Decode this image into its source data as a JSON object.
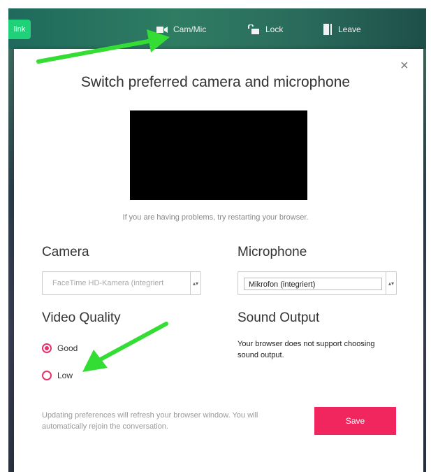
{
  "toolbar": {
    "link_label": "link",
    "cam_mic_label": "Cam/Mic",
    "lock_label": "Lock",
    "leave_label": "Leave"
  },
  "modal": {
    "title": "Switch preferred camera and microphone",
    "close_symbol": "×",
    "hint": "If you are having problems, try restarting your browser.",
    "camera": {
      "label": "Camera",
      "selected": "FaceTime HD-Kamera (integriert"
    },
    "microphone": {
      "label": "Microphone",
      "selected": "Mikrofon (integriert)"
    },
    "video_quality": {
      "label": "Video Quality",
      "options": [
        {
          "label": "Good",
          "checked": true
        },
        {
          "label": "Low",
          "checked": false
        }
      ]
    },
    "sound_output": {
      "label": "Sound Output",
      "note": "Your browser does not support choosing sound output."
    },
    "footer_note": "Updating preferences will refresh your browser window. You will automatically rejoin the conversation.",
    "save_label": "Save"
  },
  "colors": {
    "accent": "#f2265e",
    "radio": "#e8306a",
    "annotation_arrow": "#33dd33",
    "link_button": "#1fd27a"
  },
  "icons": [
    "video-camera-icon",
    "lock-icon",
    "door-icon",
    "close-icon",
    "chevron-icon"
  ]
}
